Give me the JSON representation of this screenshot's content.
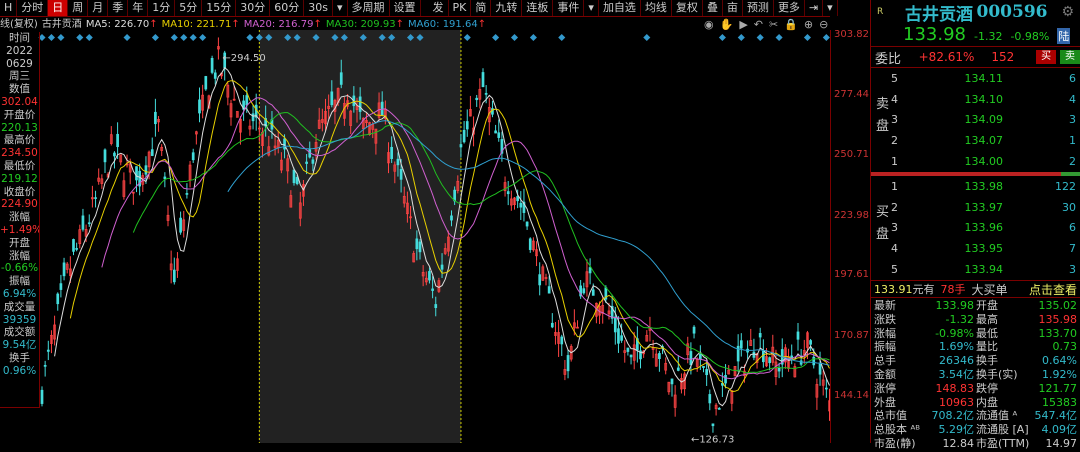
{
  "toolbar": {
    "left": [
      "H",
      "分时",
      "日",
      "周",
      "月",
      "季",
      "年",
      "1分",
      "5分",
      "15分",
      "30分",
      "60分",
      "30s",
      "▾",
      "多周期",
      "设置"
    ],
    "active": 2,
    "right": [
      "发",
      "PK",
      "简",
      "九转",
      "连板",
      "事件",
      "▾",
      "加自选",
      "均线",
      "复权",
      "叠",
      "亩",
      "预测",
      "更多",
      "⇥",
      "▾"
    ]
  },
  "ma_line": {
    "prefix": "线(复权)",
    "stock": "古井贡酒",
    "items": [
      {
        "label": "MA5: 226.70",
        "color": "#dddddd"
      },
      {
        "label": "MA10: 221.71",
        "color": "#e8d000"
      },
      {
        "label": "MA20: 216.79",
        "color": "#d060d0"
      },
      {
        "label": "MA30: 209.93",
        "color": "#20c020"
      },
      {
        "label": "MA60: 191.64",
        "color": "#30a0d0"
      }
    ],
    "arrow": "↑"
  },
  "chart_icons": [
    "eye-icon",
    "hand-icon",
    "play-icon",
    "undo-icon",
    "scissors-icon",
    "lock-icon",
    "zoom-in-icon",
    "zoom-out-icon"
  ],
  "left_panel": [
    [
      "时间",
      "lab"
    ],
    [
      "2022",
      "lab"
    ],
    [
      "0629",
      "lab"
    ],
    [
      "周三",
      "lab"
    ],
    [
      "数值",
      "lab"
    ],
    [
      "302.04",
      "r"
    ],
    [
      "开盘价",
      "lab"
    ],
    [
      "220.13",
      "g"
    ],
    [
      "最高价",
      "lab"
    ],
    [
      "234.50",
      "r"
    ],
    [
      "最低价",
      "lab"
    ],
    [
      "219.12",
      "g"
    ],
    [
      "收盘价",
      "lab"
    ],
    [
      "224.90",
      "r"
    ],
    [
      "涨幅",
      "lab"
    ],
    [
      "+1.49%",
      "r"
    ],
    [
      "开盘",
      "lab"
    ],
    [
      "涨幅",
      "lab"
    ],
    [
      "-0.66%",
      "g"
    ],
    [
      "振幅",
      "lab"
    ],
    [
      "6.94%",
      "c"
    ],
    [
      "成交量",
      "lab"
    ],
    [
      "39359",
      "c"
    ],
    [
      "成交额",
      "lab"
    ],
    [
      "9.54亿",
      "c"
    ],
    [
      "换手",
      "lab"
    ],
    [
      "0.96%",
      "c"
    ]
  ],
  "axis": {
    "labels": [
      "303.82",
      "277.44",
      "250.71",
      "223.98",
      "197.61",
      "170.87",
      "144.14"
    ],
    "range": [
      144.14,
      303.82
    ]
  },
  "chart_data": {
    "type": "candlestick",
    "high_label": "294.50",
    "low_label": "126.73",
    "high": 294.5,
    "low": 126.73,
    "path": [
      [
        0,
        150
      ],
      [
        8,
        200
      ],
      [
        17,
        232
      ],
      [
        22,
        255
      ],
      [
        30,
        240
      ],
      [
        37,
        265
      ],
      [
        42,
        195
      ],
      [
        48,
        255
      ],
      [
        53,
        285
      ],
      [
        56,
        294
      ],
      [
        63,
        270
      ],
      [
        70,
        265
      ],
      [
        77,
        250
      ],
      [
        82,
        230
      ],
      [
        87,
        262
      ],
      [
        97,
        282
      ],
      [
        102,
        265
      ],
      [
        108,
        272
      ],
      [
        115,
        232
      ],
      [
        120,
        205
      ],
      [
        125,
        188
      ],
      [
        133,
        255
      ],
      [
        140,
        282
      ],
      [
        147,
        245
      ],
      [
        153,
        228
      ],
      [
        160,
        192
      ],
      [
        167,
        158
      ],
      [
        172,
        198
      ],
      [
        178,
        190
      ],
      [
        187,
        160
      ],
      [
        193,
        178
      ],
      [
        200,
        150
      ],
      [
        207,
        168
      ],
      [
        213,
        140
      ],
      [
        220,
        157
      ],
      [
        227,
        172
      ],
      [
        233,
        160
      ],
      [
        243,
        168
      ],
      [
        250,
        143
      ]
    ],
    "highlight_range": [
      69,
      133
    ]
  },
  "quote": {
    "market": "R",
    "name": "古井贡酒",
    "code": "000596",
    "price": "133.98",
    "change": "-1.32",
    "pct": "-0.98%",
    "tag": "陆"
  },
  "weibi": {
    "label": "委比",
    "pct": "+82.61%",
    "diff": "152",
    "buy": "买",
    "sell": "卖"
  },
  "sell_side_label": "卖盘",
  "buy_side_label": "买盘",
  "asks": [
    {
      "i": "5",
      "p": "134.11",
      "v": "6"
    },
    {
      "i": "4",
      "p": "134.10",
      "v": "4"
    },
    {
      "i": "3",
      "p": "134.09",
      "v": "3"
    },
    {
      "i": "2",
      "p": "134.07",
      "v": "1"
    },
    {
      "i": "1",
      "p": "134.00",
      "v": "2"
    }
  ],
  "bids": [
    {
      "i": "1",
      "p": "133.98",
      "v": "122"
    },
    {
      "i": "2",
      "p": "133.97",
      "v": "30"
    },
    {
      "i": "3",
      "p": "133.96",
      "v": "6"
    },
    {
      "i": "4",
      "p": "133.95",
      "v": "7"
    },
    {
      "i": "5",
      "p": "133.94",
      "v": "3"
    }
  ],
  "big_order": {
    "price": "133.91",
    "has": "元有",
    "qty": "78手",
    "type": "大买单",
    "link": "点击查看"
  },
  "stats": [
    [
      "最新",
      "133.98",
      "g",
      "开盘",
      "135.02",
      "g"
    ],
    [
      "涨跌",
      "-1.32",
      "g",
      "最高",
      "135.98",
      "r"
    ],
    [
      "涨幅",
      "-0.98%",
      "g",
      "最低",
      "133.70",
      "g"
    ],
    [
      "振幅",
      "1.69%",
      "c",
      "量比",
      "0.73",
      "g"
    ],
    [
      "总手",
      "26346",
      "c",
      "换手",
      "0.64%",
      "c"
    ],
    [
      "金额",
      "3.54亿",
      "c",
      "换手(实)",
      "1.92%",
      "c"
    ],
    [
      "涨停",
      "148.83",
      "r",
      "跌停",
      "121.77",
      "g"
    ],
    [
      "外盘",
      "10963",
      "r",
      "内盘",
      "15383",
      "g"
    ],
    [
      "总市值",
      "708.2亿",
      "c",
      "流通值 ᴬ",
      "547.4亿",
      "c"
    ],
    [
      "总股本 ᴬᴮ",
      "5.29亿",
      "c",
      "流通股 [A]",
      "4.09亿",
      "c"
    ],
    [
      "市盈(静)",
      "12.84",
      "lab",
      "市盈(TTM)",
      "14.97",
      "lab"
    ]
  ]
}
